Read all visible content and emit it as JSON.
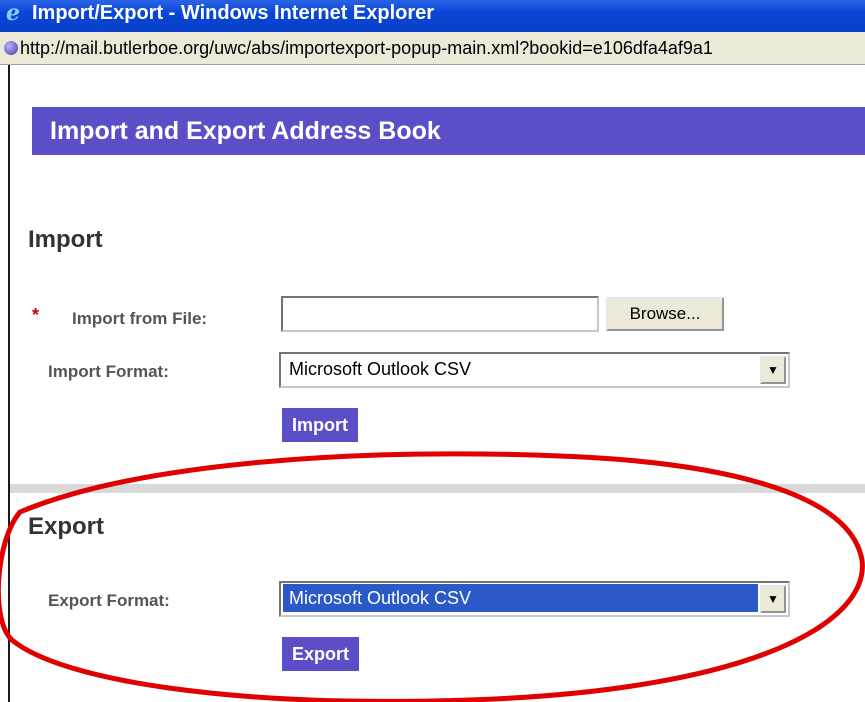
{
  "window": {
    "title": "Import/Export - Windows Internet Explorer",
    "url": "http://mail.butlerboe.org/uwc/abs/importexport-popup-main.xml?bookid=e106dfa4af9a1"
  },
  "header": {
    "title": "Import and Export Address Book"
  },
  "import_section": {
    "title": "Import",
    "required_marker": "*",
    "file_label": "Import from File:",
    "file_value": "",
    "browse_label": "Browse...",
    "format_label": "Import Format:",
    "format_value": "Microsoft Outlook CSV",
    "button_label": "Import"
  },
  "export_section": {
    "title": "Export",
    "format_label": "Export Format:",
    "format_value": "Microsoft Outlook CSV",
    "button_label": "Export"
  },
  "colors": {
    "accent": "#5a4fc6",
    "annotation": "#e00000",
    "selection": "#2b5ac8"
  },
  "icons": [
    "ie-icon",
    "globe-icon",
    "dropdown-arrow-icon"
  ]
}
